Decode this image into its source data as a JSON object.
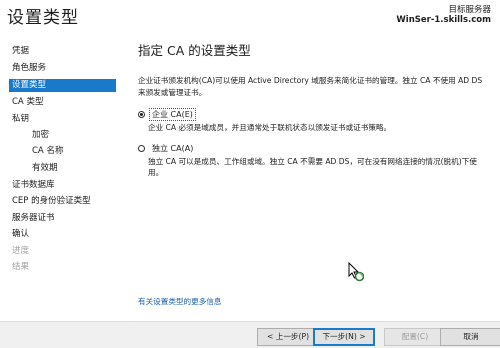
{
  "window": {
    "title": "设置类型",
    "target_label": "目标服务器",
    "target_server": "WinSer-1.skills.com"
  },
  "sidebar": {
    "items": [
      {
        "label": "凭据",
        "state": "normal"
      },
      {
        "label": "角色服务",
        "state": "normal"
      },
      {
        "label": "设置类型",
        "state": "selected"
      },
      {
        "label": "CA 类型",
        "state": "normal"
      },
      {
        "label": "私钥",
        "state": "normal"
      },
      {
        "label": "加密",
        "state": "sub"
      },
      {
        "label": "CA 名称",
        "state": "sub"
      },
      {
        "label": "有效期",
        "state": "sub"
      },
      {
        "label": "证书数据库",
        "state": "normal"
      },
      {
        "label": "CEP 的身份验证类型",
        "state": "normal"
      },
      {
        "label": "服务器证书",
        "state": "normal"
      },
      {
        "label": "确认",
        "state": "normal"
      },
      {
        "label": "进度",
        "state": "disabled"
      },
      {
        "label": "结果",
        "state": "disabled"
      }
    ]
  },
  "main": {
    "heading": "指定 CA 的设置类型",
    "intro": "企业证书颁发机构(CA)可以使用 Active Directory 域服务来简化证书的管理。独立 CA 不使用 AD DS 来颁发或管理证书。",
    "options": [
      {
        "label": "企业 CA(E)",
        "checked": true,
        "description": "企业 CA 必须是域成员，并且通常处于联机状态以颁发证书或证书策略。"
      },
      {
        "label": "独立 CA(A)",
        "checked": false,
        "description": "独立 CA 可以是成员、工作组或域。独立 CA 不需要 AD DS，可在没有网络连接的情况(脱机)下使用。"
      }
    ],
    "more_link": "有关设置类型的更多信息"
  },
  "footer": {
    "prev": "< 上一步(P)",
    "next": "下一步(N) >",
    "configure": "配置(C)",
    "cancel": "取消"
  },
  "icons": {
    "cursor": "busy-arrow-cursor-icon"
  },
  "colors": {
    "accent": "#1979ca",
    "link": "#1a5fb4"
  }
}
